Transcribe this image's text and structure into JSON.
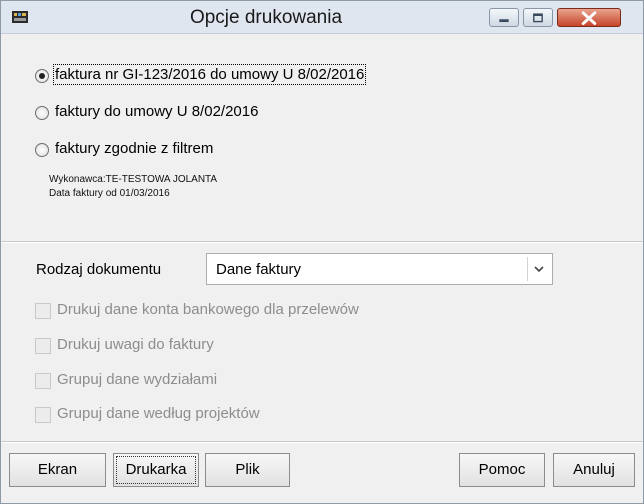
{
  "window": {
    "title": "Opcje drukowania",
    "title_buttons": [
      "minimize-icon",
      "maximize-icon",
      "close-icon"
    ]
  },
  "scope": {
    "options": [
      {
        "label": "faktura nr GI-123/2016 do umowy U 8/02/2016",
        "selected": true
      },
      {
        "label": "faktury do umowy U 8/02/2016",
        "selected": false
      },
      {
        "label": "faktury zgodnie z filtrem",
        "selected": false
      }
    ],
    "filter_info": {
      "line1": "Wykonawca:TE-TESTOWA JOLANTA",
      "line2": "Data faktury  od 01/03/2016"
    }
  },
  "document": {
    "label": "Rodzaj dokumentu",
    "selected": "Dane faktury"
  },
  "checkboxes": [
    {
      "label": "Drukuj dane konta bankowego dla przelewów",
      "checked": false,
      "enabled": false
    },
    {
      "label": "Drukuj uwagi do faktury",
      "checked": false,
      "enabled": false
    },
    {
      "label": "Grupuj dane wydziałami",
      "checked": false,
      "enabled": false
    },
    {
      "label": "Grupuj dane według projektów",
      "checked": false,
      "enabled": false
    }
  ],
  "buttons": {
    "ekran": "Ekran",
    "drukarka": "Drukarka",
    "plik": "Plik",
    "pomoc": "Pomoc",
    "anuluj": "Anuluj"
  },
  "colors": {
    "title_bar": "#dfe6ef",
    "close_button": "#c6452a",
    "disabled_text": "#8d8d8d"
  }
}
